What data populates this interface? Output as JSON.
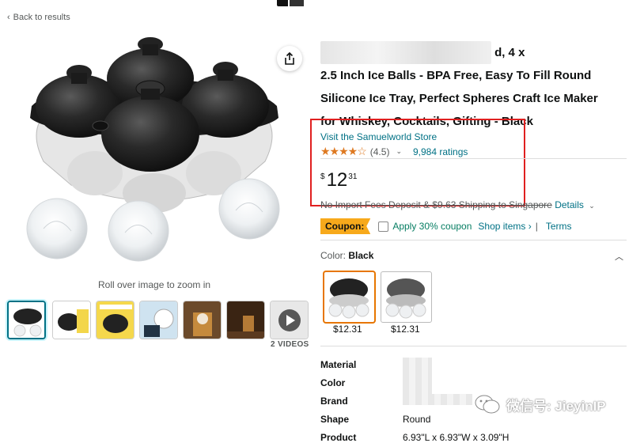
{
  "nav": {
    "back_label": "Back to results"
  },
  "gallery": {
    "rollover_hint": "Roll over image to zoom in",
    "videos_label": "2 VIDEOS"
  },
  "product": {
    "title_visible_tail_line1": "d, 4 x",
    "title_line2": "2.5 Inch Ice Balls - BPA Free, Easy To Fill Round",
    "title_line3": "Silicone Ice Tray, Perfect Spheres Craft Ice Maker",
    "title_line4": "for Whiskey, Cocktails, Gifting - Black",
    "store_link": "Visit the Samuelworld Store",
    "rating_value": "(4.5)",
    "ratings_count": "9,984 ratings",
    "price": {
      "currency": "$",
      "whole": "12",
      "fraction": "31"
    },
    "shipping_text": "No Import Fees Deposit & $9.63 Shipping to Singapore",
    "details_link": "Details",
    "coupon_badge": "Coupon:",
    "apply_coupon": "Apply 30% coupon",
    "shop_items": "Shop items ›",
    "pipe": "|",
    "terms": "Terms"
  },
  "color": {
    "label": "Color:",
    "selected": "Black",
    "options": [
      {
        "price": "$12.31",
        "variant": "black"
      },
      {
        "price": "$12.31",
        "variant": "gray"
      }
    ]
  },
  "specs": [
    {
      "key": "Material",
      "value": ""
    },
    {
      "key": "Color",
      "value": ""
    },
    {
      "key": "Brand",
      "value": ""
    },
    {
      "key": "Shape",
      "value": "Round"
    },
    {
      "key": "Product",
      "value": "6.93\"L x 6.93\"W x 3.09\"H"
    }
  ],
  "watermark": {
    "text": "微信号: JieyinIP"
  },
  "colors": {
    "link": "#007185",
    "star": "#de7921",
    "coupon": "#f7a91b",
    "highlight_box": "#e02020",
    "price": "#0f1111"
  }
}
